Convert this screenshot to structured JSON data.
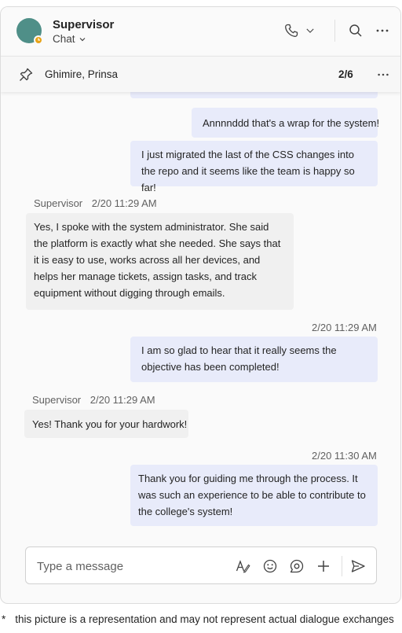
{
  "header": {
    "title": "Supervisor",
    "subtitle": "Chat"
  },
  "pinned": {
    "name": "Ghimire, Prinsa",
    "count": "2/6"
  },
  "messages": [
    {
      "text": "Annnnddd that's a wrap for the system!"
    },
    {
      "text": "I just migrated the last of the CSS changes into the repo and it seems like the team is happy so far!"
    },
    {
      "sender": "Supervisor",
      "time": "2/20 11:29 AM",
      "text": "Yes, I spoke with the system administrator. She said the platform is exactly what she needed. She says that it is easy to use, works across all her devices, and helps her manage tickets, assign tasks, and track equipment without digging through emails."
    },
    {
      "time": "2/20 11:29 AM",
      "text": "I am so glad to hear that it really seems the objective has been completed!"
    },
    {
      "sender": "Supervisor",
      "time": "2/20 11:29 AM",
      "text": "Yes! Thank you for your hardwork!"
    },
    {
      "time": "2/20 11:30 AM",
      "text": "Thank you for guiding me through the process. It was such an experience to be able to contribute to the college's system!"
    }
  ],
  "composer": {
    "placeholder": "Type a message"
  },
  "footnote": {
    "star": "*",
    "text": "this picture is a representation and may not represent actual dialogue exchanges"
  },
  "colors": {
    "outgoing_bubble": "#e8ebfa",
    "incoming_bubble": "#f0f0f0",
    "avatar": "#4f8f88",
    "presence_away": "#e8a317"
  },
  "icons": [
    "call-icon",
    "chevron-down-icon",
    "search-icon",
    "more-icon",
    "pin-icon",
    "format-icon",
    "emoji-icon",
    "loop-icon",
    "attach-plus-icon",
    "send-icon",
    "clock-icon"
  ]
}
